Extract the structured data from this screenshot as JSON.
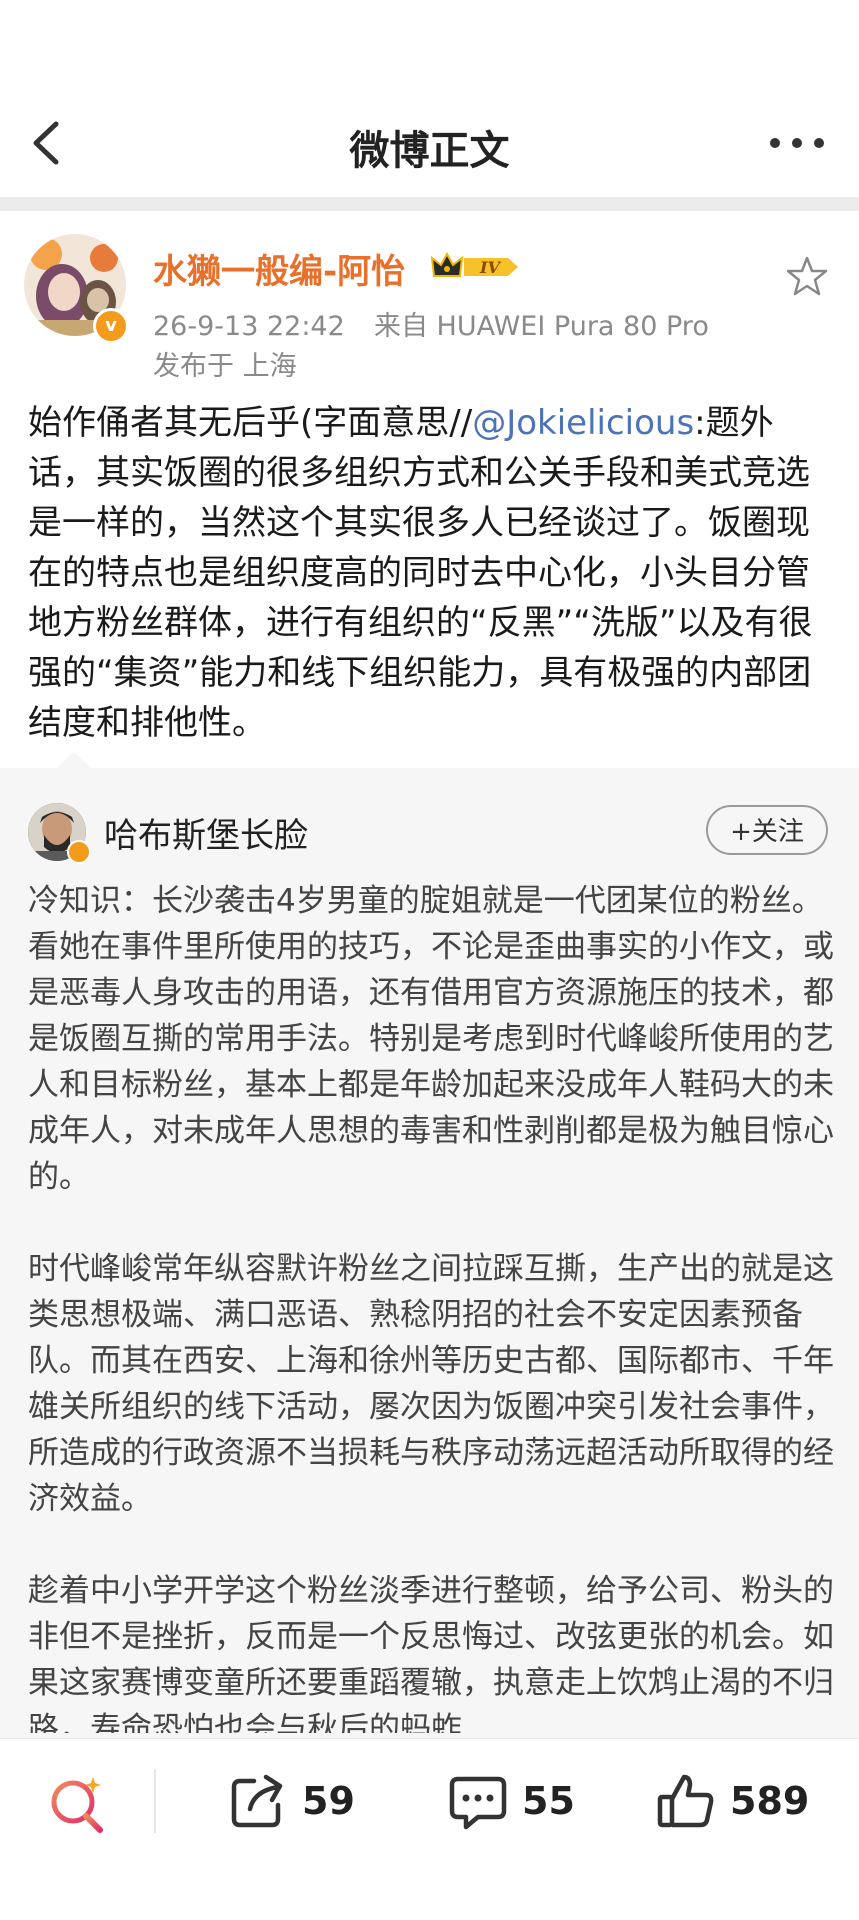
{
  "nav": {
    "title": "微博正文"
  },
  "author": {
    "name": "水獭一般编-阿怡",
    "level": "IV",
    "datetime": "26-9-13 22:42",
    "source": "来自 HUAWEI Pura 80 Pro",
    "location": "发布于 上海"
  },
  "post": {
    "text_before_mention": "始作俑者其无后乎(字面意思//",
    "mention": "@Jokielicious",
    "text_after_mention": ":题外话，其实饭圈的很多组织方式和公关手段和美式竞选是一样的，当然这个其实很多人已经谈过了。饭圈现在的特点也是组织度高的同时去中心化，小头目分管地方粉丝群体，进行有组织的“反黑”“洗版”以及有很强的“集资”能力和线下组织能力，具有极强的内部团结度和排他性。"
  },
  "quoted": {
    "name": "哈布斯堡长脸",
    "follow_label": "+关注",
    "paragraphs": [
      "冷知识：长沙袭击4岁男童的腚姐就是一代团某位的粉丝。看她在事件里所使用的技巧，不论是歪曲事实的小作文，或是恶毒人身攻击的用语，还有借用官方资源施压的技术，都是饭圈互撕的常用手法。特别是考虑到时代峰峻所使用的艺人和目标粉丝，基本上都是年龄加起来没成年人鞋码大的未成年人，对未成年人思想的毒害和性剥削都是极为触目惊心的。",
      "时代峰峻常年纵容默许粉丝之间拉踩互撕，生产出的就是这类思想极端、满口恶语、熟稔阴招的社会不安定因素预备队。而其在西安、上海和徐州等历史古都、国际都市、千年雄关所组织的线下活动，屡次因为饭圈冲突引发社会事件，所造成的行政资源不当损耗与秩序动荡远超活动所取得的经济效益。",
      "趁着中小学开学这个粉丝淡季进行整顿，给予公司、粉头的非但不是挫折，反而是一个反思悔过、改弦更张的机会。如果这家赛博变童所还要重蹈覆辙，执意走上饮鸩止渴的不归路，寿命恐怕也会与秋后的蚂蚱"
    ]
  },
  "bottom": {
    "share_count": "59",
    "comment_count": "55",
    "like_count": "589"
  },
  "colors": {
    "author_name": "#e8702a",
    "mention": "#4b73b8",
    "badge": "#f59b1b"
  },
  "icons": [
    "back-icon",
    "more-icon",
    "star-icon",
    "search-icon",
    "share-icon",
    "comment-icon",
    "like-icon"
  ]
}
